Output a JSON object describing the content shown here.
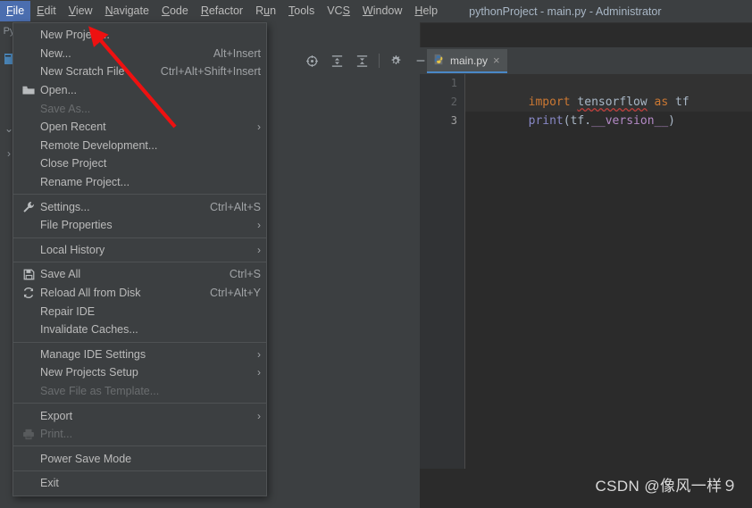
{
  "window": {
    "title": "pythonProject - main.py - Administrator"
  },
  "menubar": {
    "items": [
      {
        "label": "File",
        "mnemonic": "F",
        "active": true
      },
      {
        "label": "Edit",
        "mnemonic": "E",
        "active": false
      },
      {
        "label": "View",
        "mnemonic": "V",
        "active": false
      },
      {
        "label": "Navigate",
        "mnemonic": "N",
        "active": false
      },
      {
        "label": "Code",
        "mnemonic": "C",
        "active": false
      },
      {
        "label": "Refactor",
        "mnemonic": "R",
        "active": false
      },
      {
        "label": "Run",
        "mnemonic": "u",
        "active": false
      },
      {
        "label": "Tools",
        "mnemonic": "T",
        "active": false
      },
      {
        "label": "VCS",
        "mnemonic": "S",
        "active": false
      },
      {
        "label": "Window",
        "mnemonic": "W",
        "active": false
      },
      {
        "label": "Help",
        "mnemonic": "H",
        "active": false
      }
    ]
  },
  "left_strip": {
    "project_label": "Py"
  },
  "file_menu": {
    "items": [
      {
        "type": "item",
        "label": "New Project...",
        "accel": "",
        "icon": "",
        "arrow": false,
        "disabled": false
      },
      {
        "type": "item",
        "label": "New...",
        "accel": "Alt+Insert",
        "icon": "",
        "arrow": false,
        "disabled": false
      },
      {
        "type": "item",
        "label": "New Scratch File",
        "accel": "Ctrl+Alt+Shift+Insert",
        "icon": "",
        "arrow": false,
        "disabled": false
      },
      {
        "type": "item",
        "label": "Open...",
        "accel": "",
        "icon": "folder-icon",
        "arrow": false,
        "disabled": false
      },
      {
        "type": "item",
        "label": "Save As...",
        "accel": "",
        "icon": "",
        "arrow": false,
        "disabled": true
      },
      {
        "type": "item",
        "label": "Open Recent",
        "accel": "",
        "icon": "",
        "arrow": true,
        "disabled": false
      },
      {
        "type": "item",
        "label": "Remote Development...",
        "accel": "",
        "icon": "",
        "arrow": false,
        "disabled": false
      },
      {
        "type": "item",
        "label": "Close Project",
        "accel": "",
        "icon": "",
        "arrow": false,
        "disabled": false
      },
      {
        "type": "item",
        "label": "Rename Project...",
        "accel": "",
        "icon": "",
        "arrow": false,
        "disabled": false
      },
      {
        "type": "separator"
      },
      {
        "type": "item",
        "label": "Settings...",
        "accel": "Ctrl+Alt+S",
        "icon": "wrench-icon",
        "arrow": false,
        "disabled": false
      },
      {
        "type": "item",
        "label": "File Properties",
        "accel": "",
        "icon": "",
        "arrow": true,
        "disabled": false
      },
      {
        "type": "separator"
      },
      {
        "type": "item",
        "label": "Local History",
        "accel": "",
        "icon": "",
        "arrow": true,
        "disabled": false
      },
      {
        "type": "separator"
      },
      {
        "type": "item",
        "label": "Save All",
        "accel": "Ctrl+S",
        "icon": "save-icon",
        "arrow": false,
        "disabled": false
      },
      {
        "type": "item",
        "label": "Reload All from Disk",
        "accel": "Ctrl+Alt+Y",
        "icon": "reload-icon",
        "arrow": false,
        "disabled": false
      },
      {
        "type": "item",
        "label": "Repair IDE",
        "accel": "",
        "icon": "",
        "arrow": false,
        "disabled": false
      },
      {
        "type": "item",
        "label": "Invalidate Caches...",
        "accel": "",
        "icon": "",
        "arrow": false,
        "disabled": false
      },
      {
        "type": "separator"
      },
      {
        "type": "item",
        "label": "Manage IDE Settings",
        "accel": "",
        "icon": "",
        "arrow": true,
        "disabled": false
      },
      {
        "type": "item",
        "label": "New Projects Setup",
        "accel": "",
        "icon": "",
        "arrow": true,
        "disabled": false
      },
      {
        "type": "item",
        "label": "Save File as Template...",
        "accel": "",
        "icon": "",
        "arrow": false,
        "disabled": true
      },
      {
        "type": "separator"
      },
      {
        "type": "item",
        "label": "Export",
        "accel": "",
        "icon": "",
        "arrow": true,
        "disabled": false
      },
      {
        "type": "item",
        "label": "Print...",
        "accel": "",
        "icon": "printer-icon",
        "arrow": false,
        "disabled": true
      },
      {
        "type": "separator"
      },
      {
        "type": "item",
        "label": "Power Save Mode",
        "accel": "",
        "icon": "",
        "arrow": false,
        "disabled": false
      },
      {
        "type": "separator"
      },
      {
        "type": "item",
        "label": "Exit",
        "accel": "",
        "icon": "",
        "arrow": false,
        "disabled": false
      }
    ]
  },
  "editor_toolbar": {
    "buttons": [
      {
        "name": "select-opened-file-icon"
      },
      {
        "name": "expand-all-icon"
      },
      {
        "name": "collapse-all-icon"
      },
      {
        "name": "settings-gear-icon"
      },
      {
        "name": "hide-panel-icon"
      }
    ]
  },
  "tabs": [
    {
      "label": "main.py",
      "icon": "python-file-icon",
      "active": true,
      "close": "×"
    }
  ],
  "editor": {
    "line_numbers": [
      "1",
      "2",
      "3"
    ],
    "lines": [
      {
        "tokens": [
          {
            "text": "import ",
            "cls": "kw"
          },
          {
            "text": "tensorflow",
            "cls": "ident squiggle"
          },
          {
            "text": " as ",
            "cls": "kw"
          },
          {
            "text": "tf",
            "cls": "ident"
          }
        ]
      },
      {
        "tokens": [
          {
            "text": "print",
            "cls": "fn"
          },
          {
            "text": "(",
            "cls": "paren"
          },
          {
            "text": "tf",
            "cls": "ident"
          },
          {
            "text": ".",
            "cls": "punct"
          },
          {
            "text": "__version__",
            "cls": "dunder"
          },
          {
            "text": ")",
            "cls": "paren"
          }
        ]
      },
      {
        "tokens": []
      }
    ]
  },
  "annotation": {
    "arrow_color": "#ee1111",
    "target_label": "New Project..."
  },
  "watermark": {
    "text": "CSDN @像风一样９"
  },
  "colors": {
    "accent_blue": "#4b6eaf",
    "tab_underline": "#4a88c7",
    "panel_bg": "#3c3f41",
    "editor_bg": "#2b2b2b",
    "keyword_orange": "#cc7832",
    "dunder_purple": "#b389c5",
    "function_blue": "#8888c6"
  }
}
